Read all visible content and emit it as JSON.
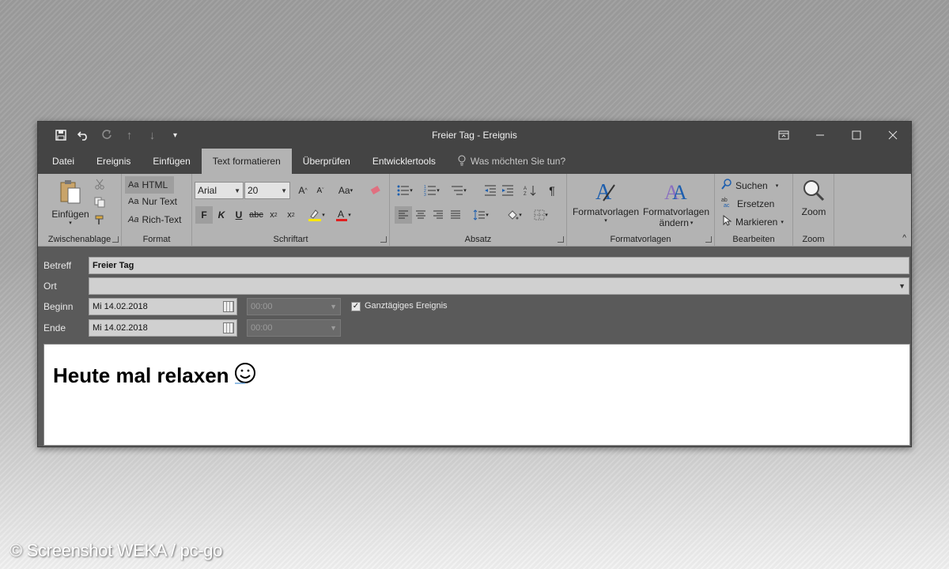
{
  "window": {
    "title": "Freier Tag  -  Ereignis"
  },
  "qat": {
    "icons": [
      "save-icon",
      "undo-icon",
      "redo-icon",
      "arrow-up-icon",
      "arrow-down-icon",
      "customize-icon"
    ]
  },
  "tabs": [
    {
      "label": "Datei",
      "active": false
    },
    {
      "label": "Ereignis",
      "active": false
    },
    {
      "label": "Einfügen",
      "active": false
    },
    {
      "label": "Text formatieren",
      "active": true
    },
    {
      "label": "Überprüfen",
      "active": false
    },
    {
      "label": "Entwicklertools",
      "active": false
    }
  ],
  "tell_me": {
    "placeholder": "Was möchten Sie tun?"
  },
  "ribbon": {
    "clipboard": {
      "label": "Zwischenablage",
      "paste": "Einfügen"
    },
    "format": {
      "label": "Format",
      "html": "HTML",
      "plain": "Nur Text",
      "rich": "Rich-Text",
      "aa": "Aa"
    },
    "font": {
      "label": "Schriftart",
      "family": "Arial",
      "size": "20"
    },
    "paragraph": {
      "label": "Absatz"
    },
    "styles": {
      "label": "Formatvorlagen",
      "styles_btn": "Formatvorlagen",
      "change_btn_1": "Formatvorlagen",
      "change_btn_2": "ändern"
    },
    "editing": {
      "label": "Bearbeiten",
      "find": "Suchen",
      "replace": "Ersetzen",
      "select": "Markieren"
    },
    "zoom": {
      "label": "Zoom",
      "btn": "Zoom"
    }
  },
  "form": {
    "subject": {
      "label": "Betreff",
      "value": "Freier Tag"
    },
    "location": {
      "label": "Ort",
      "value": ""
    },
    "start": {
      "label": "Beginn",
      "date": "Mi 14.02.2018",
      "time": "00:00"
    },
    "end": {
      "label": "Ende",
      "date": "Mi 14.02.2018",
      "time": "00:00"
    },
    "all_day": {
      "label": "Ganztägiges Ereignis",
      "checked": true
    }
  },
  "body": {
    "text": "Heute mal relaxen"
  },
  "watermark": "© Screenshot WEKA / pc-go"
}
